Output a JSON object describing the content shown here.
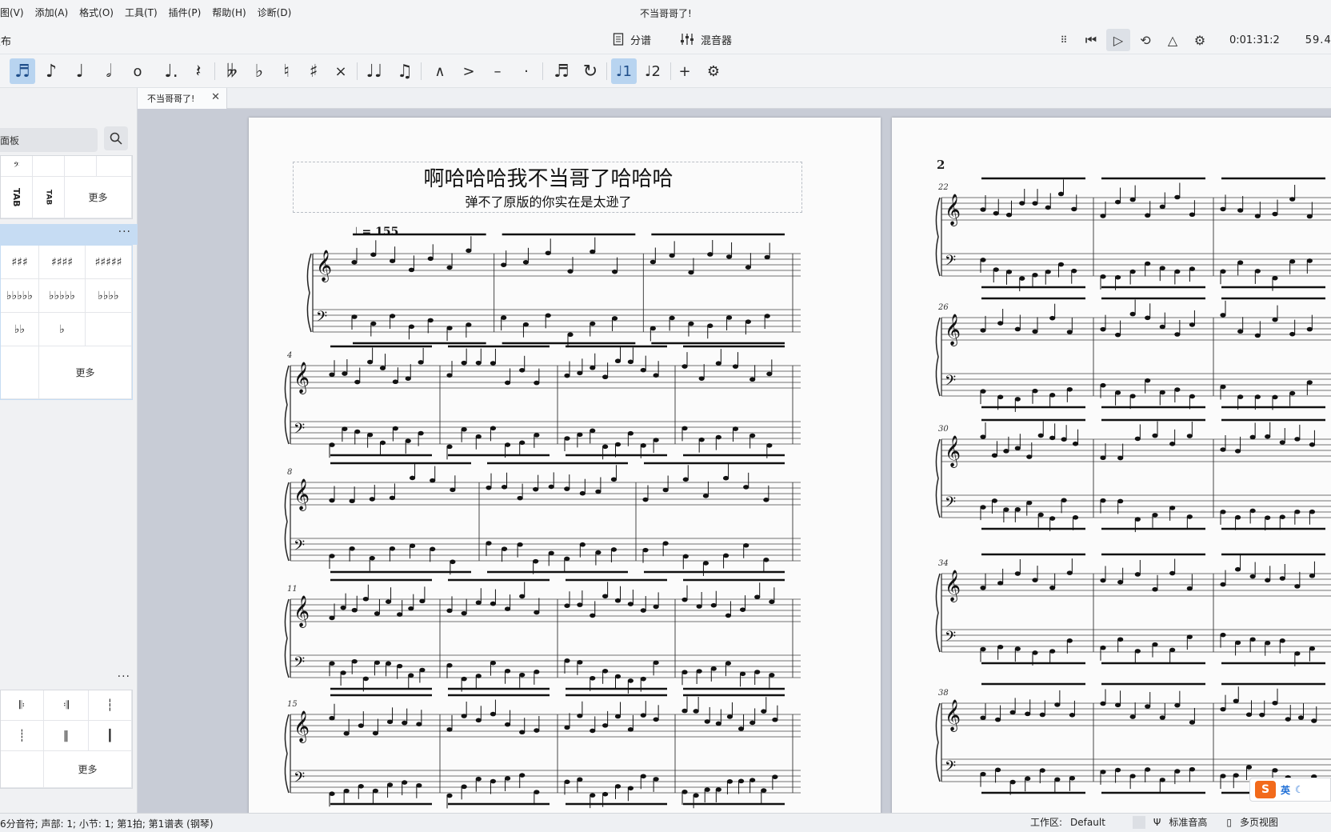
{
  "menu": [
    "图(V)",
    "添加(A)",
    "格式(O)",
    "工具(T)",
    "插件(P)",
    "帮助(H)",
    "诊断(D)"
  ],
  "window_title": "不当哥哥了!",
  "bar2": {
    "left_label": "发布",
    "parts_label": "分谱",
    "mixer_label": "混音器",
    "time": "0:01:31:2",
    "tempo": "59.4"
  },
  "toolbar": {
    "icons": [
      "note-input-icon",
      "eighth-note-icon",
      "quarter-note-icon",
      "half-note-icon",
      "whole-note-icon",
      "dotted-note-icon",
      "rest-icon",
      "double-flat-icon",
      "flat-icon",
      "natural-icon",
      "sharp-icon",
      "double-sharp-icon",
      "tie-icon",
      "slur-icon",
      "marcato-icon",
      "accent-icon",
      "tenuto-icon",
      "staccato-icon",
      "tuplet-icon",
      "flip-icon",
      "voice1-icon",
      "voice2-icon",
      "add-icon",
      "customize-icon"
    ]
  },
  "panel": {
    "search_placeholder": "面板",
    "more_label": "更多",
    "tab_label": "TAB"
  },
  "tab": {
    "label": "不当哥哥了!"
  },
  "score": {
    "title": "啊哈哈哈我不当哥了哈哈哈",
    "subtitle": "弹不了原版的你实在是太逊了",
    "tempo_mark": "♩ = 155",
    "page2_number": "2",
    "measure_numbers_p1": [
      "4",
      "8",
      "11",
      "15"
    ],
    "measure_numbers_p2": [
      "22",
      "26",
      "30",
      "34",
      "38"
    ]
  },
  "status": {
    "left": "6分音符; 声部: 1; 小节: 1; 第1拍; 第1谱表 (钢琴)",
    "workspace_label": "工作区:",
    "workspace_value": "Default",
    "concert_pitch": "标准音高",
    "view_mode": "多页视图"
  },
  "ime": {
    "logo": "S",
    "lang": "英"
  }
}
